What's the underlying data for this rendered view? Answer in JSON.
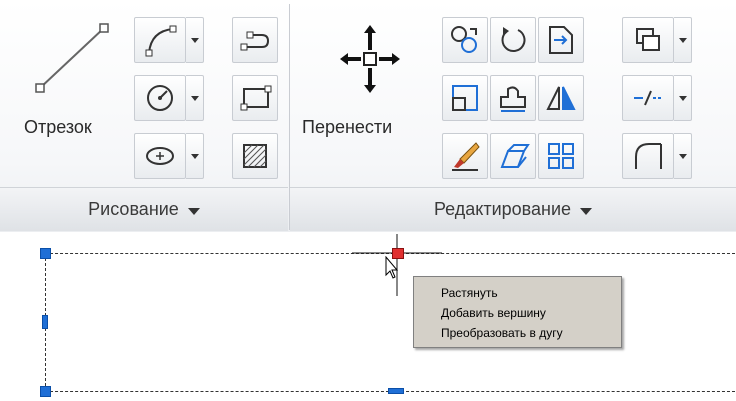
{
  "ribbon": {
    "draw_panel": {
      "title": "Рисование",
      "line_button": {
        "label": "Отрезок",
        "icon": "line-icon"
      },
      "tools": [
        {
          "icon": "arc-icon",
          "has_dropdown": true
        },
        {
          "icon": "polyline-icon",
          "has_dropdown": false
        },
        {
          "icon": "circle-icon",
          "has_dropdown": true
        },
        {
          "icon": "rectangle-icon",
          "has_dropdown": false
        },
        {
          "icon": "ellipse-icon",
          "has_dropdown": true
        },
        {
          "icon": "hatch-icon",
          "has_dropdown": false
        }
      ]
    },
    "edit_panel": {
      "title": "Редактирование",
      "move_button": {
        "label": "Перенести",
        "icon": "move-icon"
      },
      "tools": [
        {
          "icon": "copy-icon"
        },
        {
          "icon": "rotate-icon"
        },
        {
          "icon": "trim-icon"
        },
        {
          "icon": "draw-order-icon",
          "has_dropdown": true
        },
        {
          "icon": "scale-icon"
        },
        {
          "icon": "stretch-icon"
        },
        {
          "icon": "mirror-icon"
        },
        {
          "icon": "break-icon",
          "has_dropdown": true
        },
        {
          "icon": "erase-icon"
        },
        {
          "icon": "explode-icon"
        },
        {
          "icon": "array-icon"
        },
        {
          "icon": "fillet-icon",
          "has_dropdown": true
        }
      ]
    }
  },
  "context_menu": {
    "items": [
      "Растянуть",
      "Добавить вершину",
      "Преобразовать в дугу"
    ]
  },
  "colors": {
    "grip": "#1f6fd6",
    "hot_grip": "#e03030",
    "menu_bg": "#d4d0c8"
  }
}
